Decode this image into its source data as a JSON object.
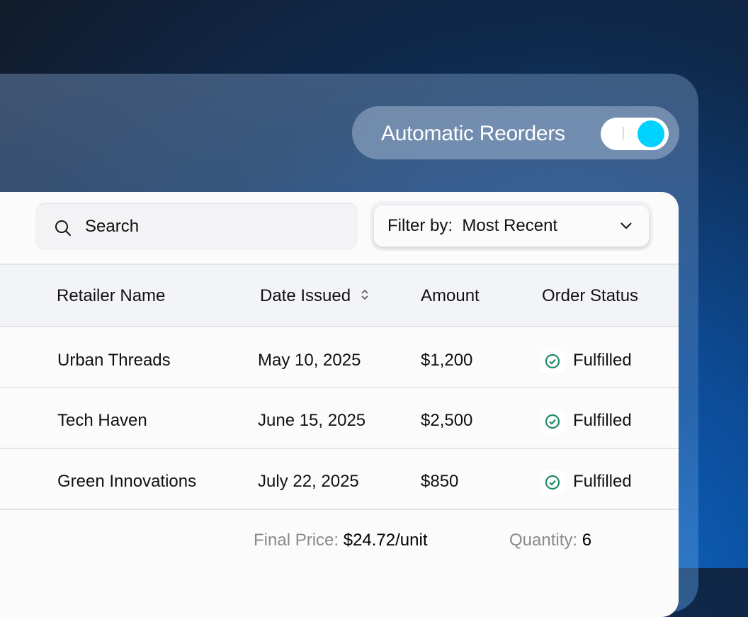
{
  "toggle": {
    "label": "Automatic Reorders",
    "on": true,
    "knob_color": "#00d1ff"
  },
  "search": {
    "placeholder": "Search"
  },
  "filter": {
    "label": "Filter by:",
    "value": "Most Recent"
  },
  "table": {
    "columns": [
      "Retailer Name",
      "Date Issued",
      "Amount",
      "Order Status"
    ],
    "rows": [
      {
        "retailer": "Urban Threads",
        "date": "May 10, 2025",
        "amount": "$1,200",
        "status": "Fulfilled"
      },
      {
        "retailer": "Tech Haven",
        "date": "June 15, 2025",
        "amount": "$2,500",
        "status": "Fulfilled"
      },
      {
        "retailer": "Green Innovations",
        "date": "July 22, 2025",
        "amount": "$850",
        "status": "Fulfilled"
      }
    ]
  },
  "footer": {
    "price_label": "Final Price:",
    "price_value": "$24.72/unit",
    "qty_label": "Quantity:",
    "qty_value": "6"
  },
  "colors": {
    "status_green": "#1f8a66"
  }
}
